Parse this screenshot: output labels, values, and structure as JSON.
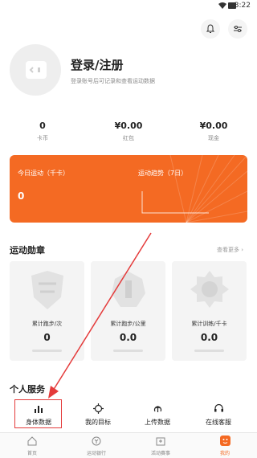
{
  "status": {
    "time": "3:22"
  },
  "header": {
    "bell_icon": "bell-icon",
    "settings_icon": "sliders-icon"
  },
  "profile": {
    "title": "登录/注册",
    "hint": "登录账号后可记录和查看运动数据"
  },
  "stats": [
    {
      "value": "0",
      "label": "卡币"
    },
    {
      "value": "¥0.00",
      "label": "红包"
    },
    {
      "value": "¥0.00",
      "label": "现金"
    }
  ],
  "sport_card": {
    "today_label": "今日运动（千卡）",
    "today_value": "0",
    "trend_label": "运动趋势（7日）",
    "color": "#f46a23"
  },
  "medals": {
    "title": "运动勋章",
    "more": "查看更多 ›",
    "items": [
      {
        "label": "累计跑步/次",
        "value": "0"
      },
      {
        "label": "累计跑步/公里",
        "value": "0.0"
      },
      {
        "label": "累计训练/千卡",
        "value": "0.0"
      }
    ]
  },
  "services": {
    "title": "个人服务",
    "items": [
      {
        "label": "身体数据",
        "icon": "bar-chart-icon"
      },
      {
        "label": "我的目标",
        "icon": "target-icon"
      },
      {
        "label": "上传数据",
        "icon": "upload-icon"
      },
      {
        "label": "在线客服",
        "icon": "headset-icon"
      }
    ]
  },
  "bottom_nav": [
    {
      "label": "首页",
      "icon": "home-icon"
    },
    {
      "label": "运动银行",
      "icon": "bank-icon"
    },
    {
      "label": "活动赛事",
      "icon": "event-icon"
    },
    {
      "label": "我的",
      "icon": "me-icon",
      "active": true
    }
  ]
}
